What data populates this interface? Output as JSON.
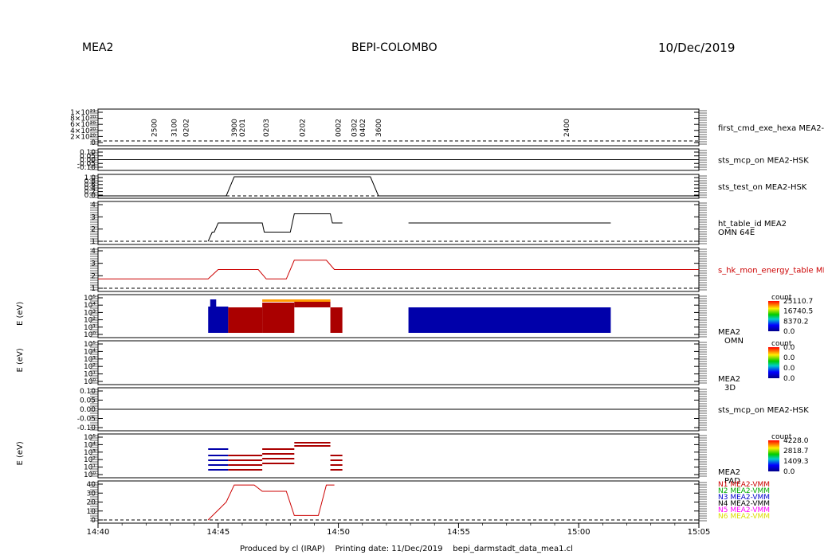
{
  "header": {
    "left": "MEA2",
    "center": "BEPI-COLOMBO",
    "right": "10/Dec/2019"
  },
  "footer": "Produced by cl (IRAP)    Printing date: 11/Dec/2019    bepi_darmstadt_data_mea1.cl",
  "colors": {
    "ink": "#000000",
    "energy_table": "#cc0000",
    "dark_red": "#aa0000",
    "dark_blue": "#0000aa",
    "orange": "#ff9900"
  },
  "chart_data": [
    {
      "type": "line",
      "panel": "first_cmd_exe_hexa",
      "side_label": "first_cmd_exe_hexa MEA2-",
      "y_tick_labels": [
        "1×10²¹",
        "8×10²⁰",
        "6×10²⁰",
        "4×10²⁰",
        "2×10²⁰",
        "0"
      ],
      "annotations": [
        {
          "t": "14:42:20",
          "label": "2500"
        },
        {
          "t": "14:43:10",
          "label": "3100"
        },
        {
          "t": "14:43:40",
          "label": "0202"
        },
        {
          "t": "14:45:40",
          "label": "3900"
        },
        {
          "t": "14:46:00",
          "label": "0201"
        },
        {
          "t": "14:47:00",
          "label": "0203"
        },
        {
          "t": "14:48:30",
          "label": "0202"
        },
        {
          "t": "14:50:00",
          "label": "0002"
        },
        {
          "t": "14:50:40",
          "label": "0302"
        },
        {
          "t": "14:51:00",
          "label": "0402"
        },
        {
          "t": "14:51:40",
          "label": "3600"
        },
        {
          "t": "14:59:30",
          "label": "2400"
        }
      ]
    },
    {
      "type": "line",
      "panel": "sts_mcp_on_1",
      "side_label": "sts_mcp_on MEA2-HSK",
      "y_tick_labels": [
        "0.10",
        "0.05",
        "0.00",
        "-0.05",
        "-0.10"
      ],
      "series": [
        {
          "values": [
            [
              "14:40",
              0
            ],
            [
              "15:05",
              0
            ]
          ]
        }
      ]
    },
    {
      "type": "line",
      "panel": "sts_test_on",
      "side_label": "sts_test_on MEA2-HSK",
      "y_tick_labels": [
        "1.0",
        "0.8",
        "0.6",
        "0.4",
        "0.2",
        "0.0"
      ],
      "series": [
        {
          "values": [
            [
              "14:40",
              0
            ],
            [
              "14:45:20",
              0
            ],
            [
              "14:45:40",
              1
            ],
            [
              "14:51:20",
              1
            ],
            [
              "14:51:40",
              0
            ],
            [
              "15:05",
              0
            ]
          ]
        }
      ]
    },
    {
      "type": "line",
      "panel": "ht_table_id",
      "side_label": "ht_table_id MEA2",
      "side_label_2": "OMN 64E",
      "y_tick_labels": [
        "4",
        "3",
        "2",
        "1"
      ],
      "series": [
        {
          "values": [
            [
              "14:44:35",
              0
            ],
            [
              "14:44:45",
              1
            ],
            [
              "14:44:50",
              1
            ],
            [
              "14:45:00",
              2
            ],
            [
              "14:46:50",
              2
            ],
            [
              "14:46:55",
              1
            ],
            [
              "14:48:00",
              1
            ],
            [
              "14:48:10",
              3
            ],
            [
              "14:49:40",
              3
            ],
            [
              "14:49:45",
              2
            ],
            [
              "14:50:10",
              2
            ]
          ]
        },
        {
          "values": [
            [
              "14:52:55",
              2
            ],
            [
              "15:01:20",
              2
            ]
          ]
        }
      ]
    },
    {
      "type": "line",
      "panel": "s_hk_mon_energy_table",
      "side_label": "s_hk_mon_energy_table ME",
      "y_tick_labels": [
        "4",
        "3",
        "2",
        "1"
      ],
      "series": [
        {
          "values": [
            [
              "14:40",
              1
            ],
            [
              "14:44:35",
              1
            ],
            [
              "14:45:00",
              2
            ],
            [
              "14:46:40",
              2
            ],
            [
              "14:47:00",
              1
            ],
            [
              "14:47:50",
              1
            ],
            [
              "14:48:10",
              3
            ],
            [
              "14:49:30",
              3
            ],
            [
              "14:49:50",
              2
            ],
            [
              "15:05",
              2
            ]
          ]
        }
      ]
    },
    {
      "type": "heatmap",
      "panel": "mea2_omn",
      "ylabel": "E (eV)",
      "side_label": "MEA2",
      "side_label_2": "OMN",
      "y_tick_labels": [
        "10⁵",
        "10⁴",
        "10³",
        "10²",
        "10¹",
        "10⁰"
      ],
      "colorbar": {
        "title": "count",
        "ticks": [
          "25110.7",
          "16740.5",
          "8370.2",
          "0.0"
        ]
      }
    },
    {
      "type": "heatmap",
      "panel": "mea2_3d",
      "ylabel": "E (eV)",
      "side_label": "MEA2",
      "side_label_2": "3D",
      "y_tick_labels": [
        "10⁵",
        "10⁴",
        "10³",
        "10²",
        "10¹",
        "10⁰"
      ],
      "colorbar": {
        "title": "count",
        "ticks": [
          "0.0",
          "0.0",
          "0.0",
          "0.0"
        ]
      }
    },
    {
      "type": "line",
      "panel": "sts_mcp_on_2",
      "side_label": "sts_mcp_on MEA2-HSK",
      "y_tick_labels": [
        "0.10",
        "0.05",
        "0.00",
        "-0.05",
        "-0.10"
      ],
      "series": [
        {
          "values": [
            [
              "14:40",
              0
            ],
            [
              "15:05",
              0
            ]
          ]
        }
      ]
    },
    {
      "type": "heatmap",
      "panel": "mea2_pad",
      "ylabel": "E (eV)",
      "side_label": "MEA2",
      "side_label_2": "PAD",
      "y_tick_labels": [
        "10⁵",
        "10⁴",
        "10³",
        "10²",
        "10¹",
        "10⁰"
      ],
      "colorbar": {
        "title": "count",
        "ticks": [
          "4228.0",
          "2818.7",
          "1409.3",
          "0.0"
        ]
      }
    },
    {
      "type": "line",
      "panel": "vmm",
      "y_tick_labels": [
        "40",
        "30",
        "20",
        "10",
        "0"
      ],
      "x_tick_labels": [
        "14:40",
        "14:45",
        "14:50",
        "14:55",
        "15:00",
        "15:05"
      ],
      "series": [
        {
          "name": "N1 MEA2-VMM",
          "color": "#cc0000",
          "values": [
            [
              "14:44:35",
              0
            ],
            [
              "14:45:20",
              20
            ],
            [
              "14:45:40",
              39
            ],
            [
              "14:46:30",
              39
            ],
            [
              "14:46:50",
              32
            ],
            [
              "14:47:50",
              32
            ],
            [
              "14:48:10",
              5
            ],
            [
              "14:49:10",
              5
            ],
            [
              "14:49:30",
              39
            ],
            [
              "14:49:50",
              39
            ]
          ]
        },
        {
          "name": "N2 MEA2-VMM",
          "color": "#00aa00"
        },
        {
          "name": "N3 MEA2-VMM",
          "color": "#0000cc"
        },
        {
          "name": "N4 MEA2-VMM",
          "color": "#000000"
        },
        {
          "name": "N5 MEA2-VMM",
          "color": "#ff00ff"
        },
        {
          "name": "N6 MEA2-VMM",
          "color": "#dddd00"
        }
      ]
    }
  ]
}
